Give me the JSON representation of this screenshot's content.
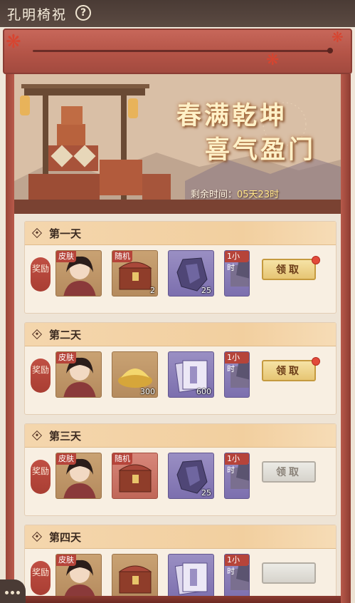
{
  "header": {
    "title": "孔明椅祝",
    "help_label": "?"
  },
  "hero": {
    "line1": "春满乾坤",
    "line2": "喜气盈门",
    "timer_label": "剩余时间：",
    "timer_value": "05天23时"
  },
  "reward_label": "奖励",
  "days": [
    {
      "title": "第一天",
      "items": [
        {
          "kind": "skin",
          "badge": "皮肤",
          "qty": ""
        },
        {
          "kind": "chest",
          "badge": "随机",
          "qty": "2"
        },
        {
          "kind": "stone",
          "badge": "",
          "qty": "25"
        },
        {
          "kind": "hour",
          "badge": "1小时",
          "qty": ""
        }
      ],
      "button": "领取",
      "state": "active"
    },
    {
      "title": "第二天",
      "items": [
        {
          "kind": "skin",
          "badge": "皮肤",
          "qty": ""
        },
        {
          "kind": "ingot",
          "badge": "",
          "qty": "300"
        },
        {
          "kind": "book",
          "badge": "",
          "qty": "600"
        },
        {
          "kind": "hour",
          "badge": "1小时",
          "qty": ""
        }
      ],
      "button": "领取",
      "state": "active"
    },
    {
      "title": "第三天",
      "items": [
        {
          "kind": "skin",
          "badge": "皮肤",
          "qty": ""
        },
        {
          "kind": "chest",
          "badge": "随机",
          "qty": ""
        },
        {
          "kind": "stone",
          "badge": "",
          "qty": "25"
        },
        {
          "kind": "hour",
          "badge": "1小时",
          "qty": ""
        }
      ],
      "button": "领取",
      "state": "disabled"
    },
    {
      "title": "第四天",
      "items": [
        {
          "kind": "skin",
          "badge": "皮肤",
          "qty": ""
        },
        {
          "kind": "chest",
          "badge": "",
          "qty": ""
        },
        {
          "kind": "book",
          "badge": "",
          "qty": ""
        },
        {
          "kind": "hour",
          "badge": "1小时",
          "qty": ""
        }
      ],
      "button": "",
      "state": "disabled"
    }
  ],
  "colors": {
    "accent_red": "#b6443a",
    "gold": "#e6c573",
    "header_bg": "#4a3b35"
  },
  "icons": {
    "help": "question-circle-icon",
    "chat": "chat-bubble-icon",
    "leaf": "maple-leaf-icon"
  }
}
